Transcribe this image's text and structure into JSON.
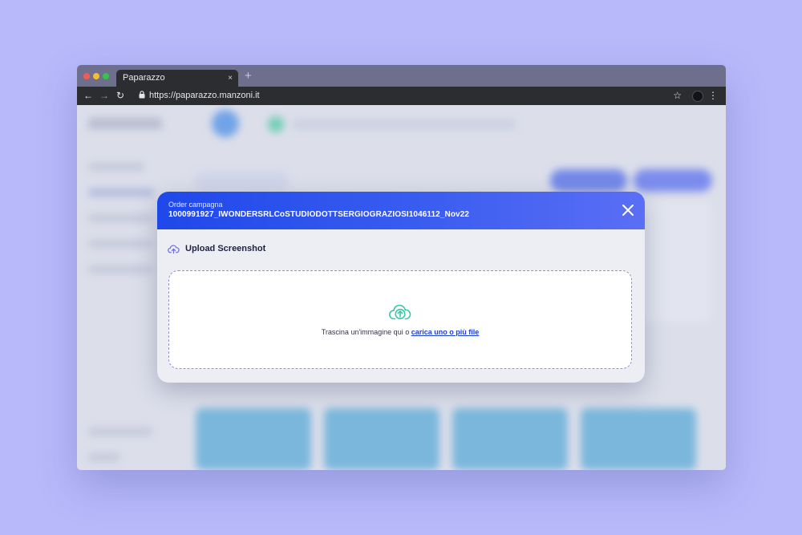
{
  "browser": {
    "tab_title": "Paparazzo",
    "tab_close": "×",
    "new_tab": "+",
    "url": "https://paparazzo.manzoni.it",
    "back": "←",
    "forward": "→",
    "reload": "↻",
    "bookmark": "☆",
    "menu": "⋮"
  },
  "modal": {
    "label": "Order campagna",
    "title": "1000991927_IWONDERSRLCoSTUDIODOTTSERGIOGRAZIOSI1046112_Nov22",
    "section_title": "Upload Screenshot",
    "drop_text": "Trascina un'immagine qui o ",
    "drop_link": "carica uno o più file"
  },
  "colors": {
    "page_background": "#b7b9fb",
    "header_gradient_start": "#1f48ea",
    "header_gradient_end": "#5b6ef5",
    "link": "#1b3fd6",
    "cloud_icon": "#3cc7a8"
  },
  "icons": {
    "close": "close-icon",
    "section": "cloud-upload-icon",
    "dropzone": "cloud-upload-icon",
    "lock": "lock-icon"
  }
}
